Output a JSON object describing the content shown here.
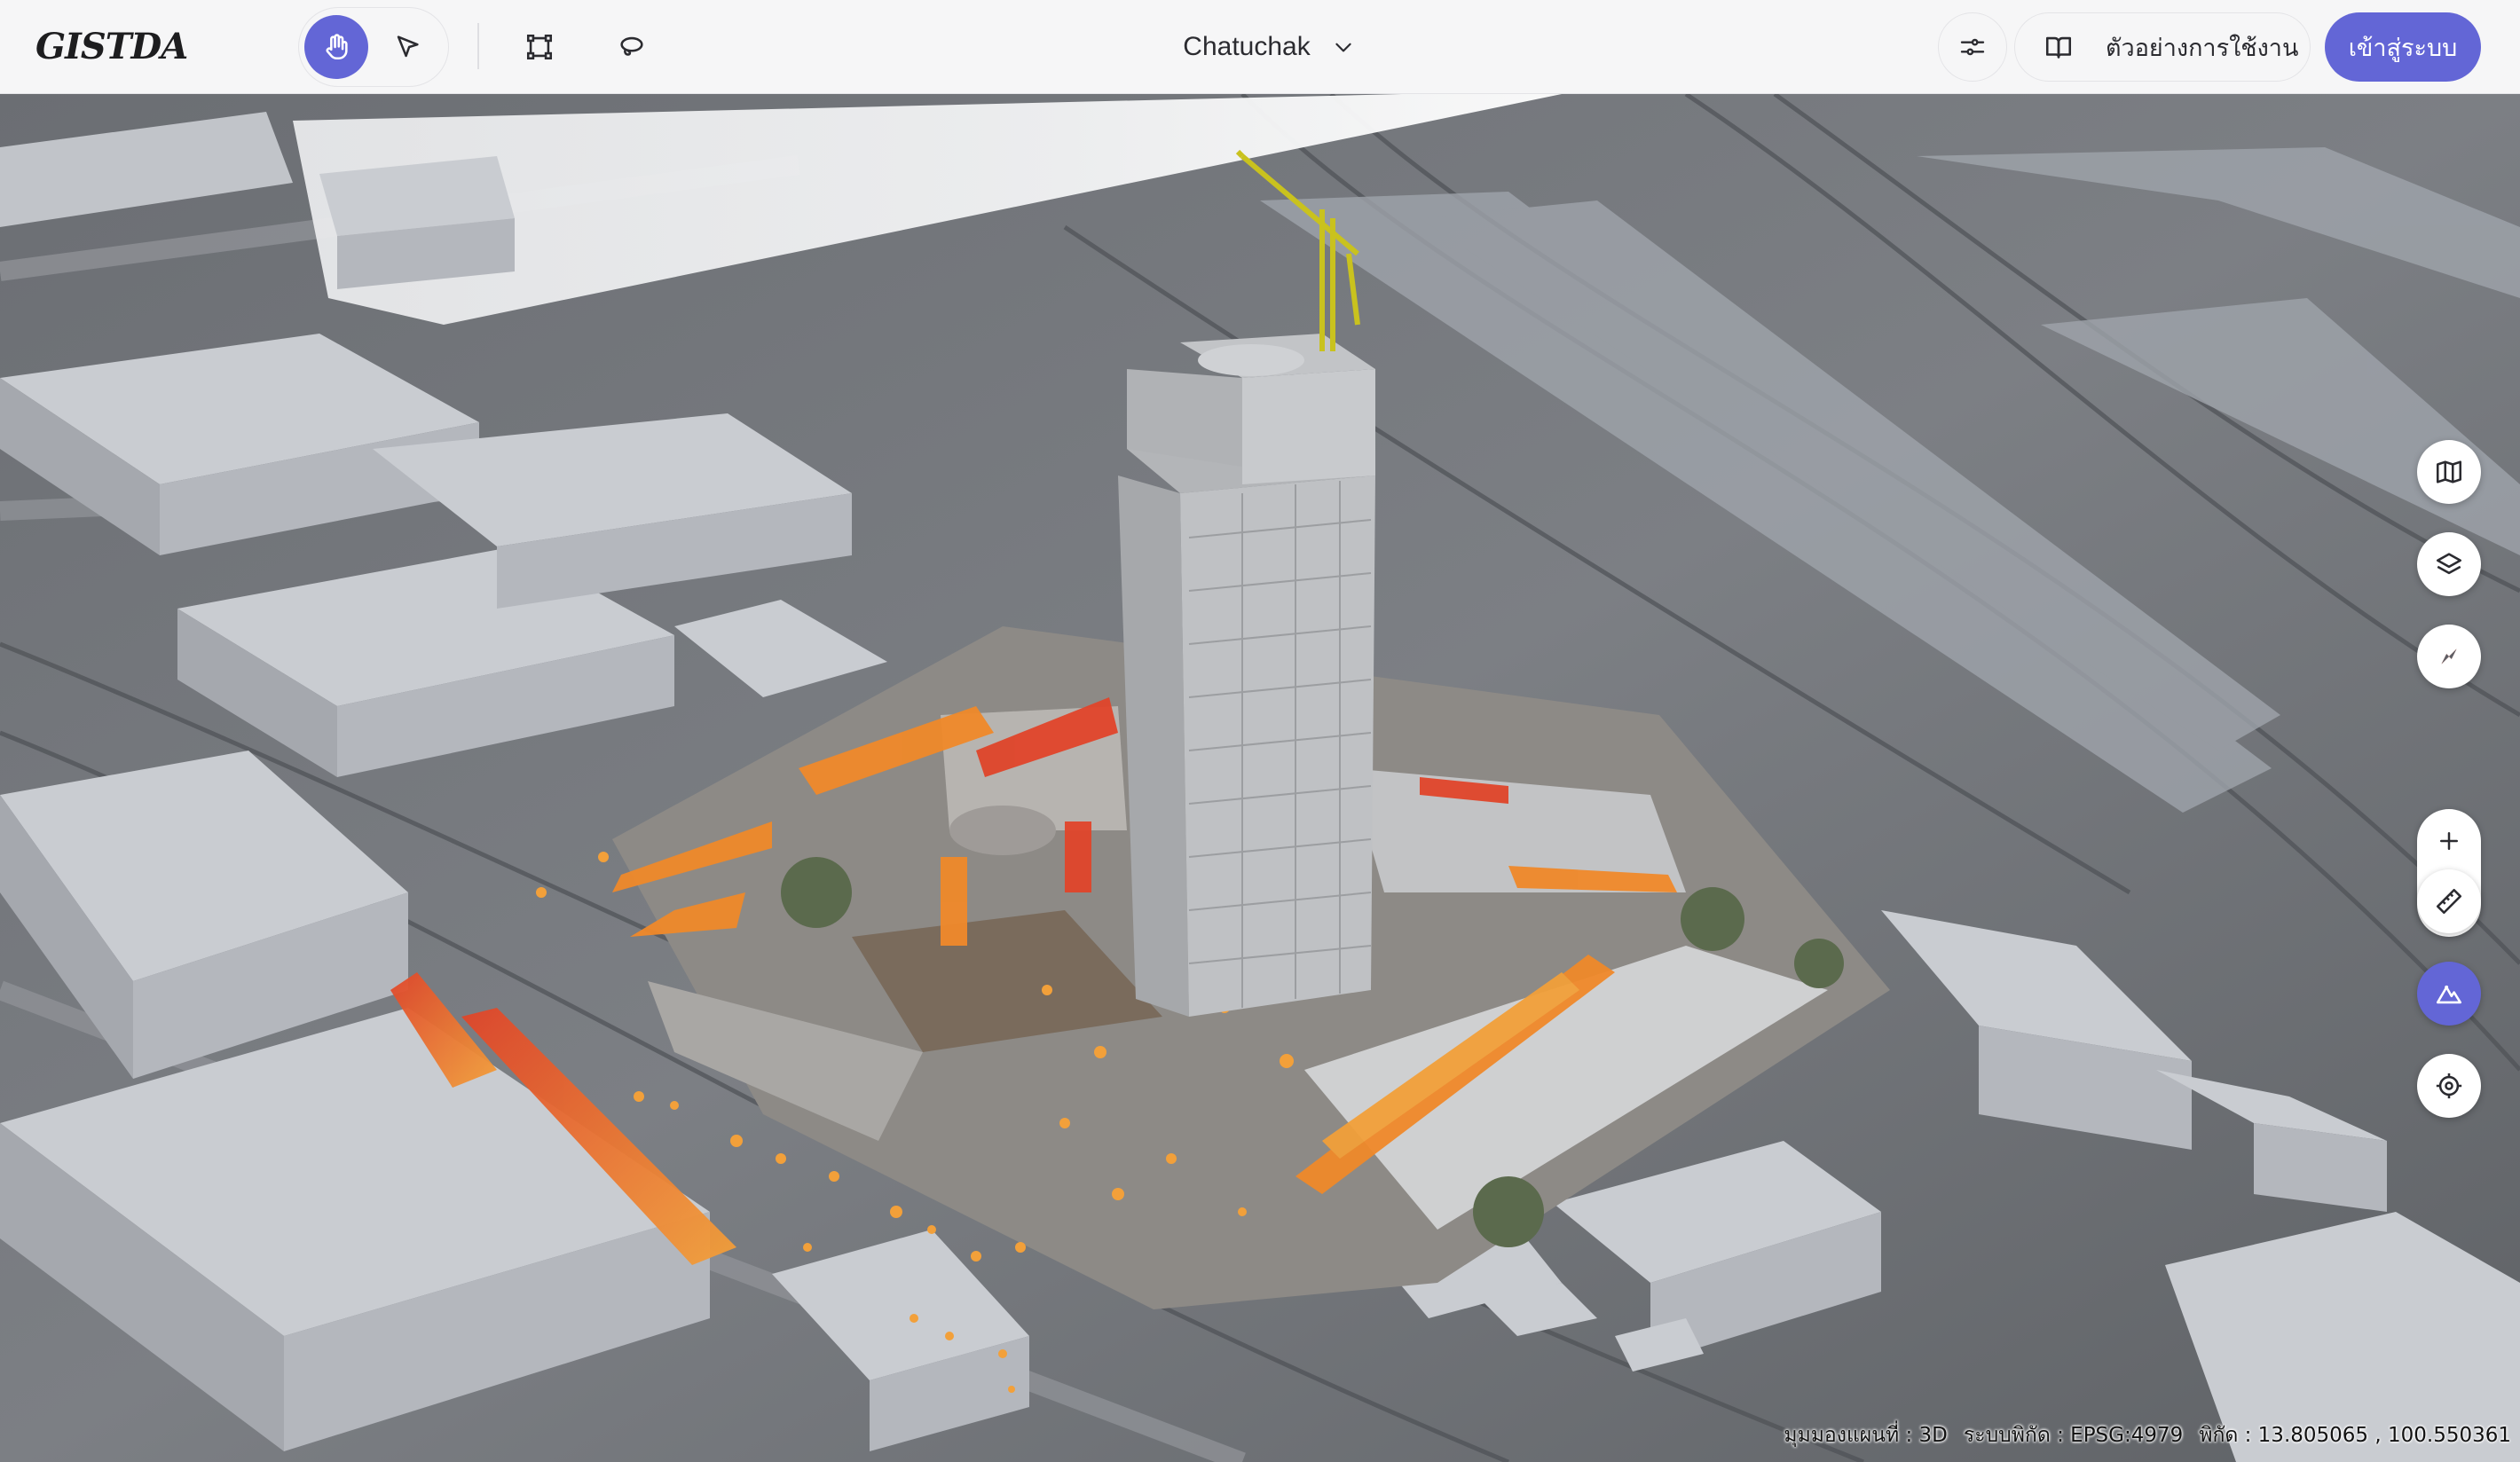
{
  "app": {
    "logo_text": "GISTDA"
  },
  "toolbar": {
    "tools": [
      {
        "name": "pan",
        "icon": "hand-icon",
        "active": true
      },
      {
        "name": "select",
        "icon": "cursor-arrow-icon",
        "active": false
      },
      {
        "name": "polygon",
        "icon": "polygon-draw-icon",
        "active": false
      },
      {
        "name": "lasso",
        "icon": "lasso-icon",
        "active": false
      }
    ],
    "location": "Chatuchak",
    "filter_icon": "sliders-icon",
    "guide_label": "ตัวอย่างการใช้งาน",
    "guide_icon": "book-open-icon",
    "login_label": "เข้าสู่ระบบ"
  },
  "map_controls": [
    {
      "name": "basemap",
      "icon": "map-icon"
    },
    {
      "name": "layers",
      "icon": "layers-icon"
    },
    {
      "name": "compass",
      "icon": "compass-icon"
    },
    {
      "name": "zoom-in",
      "icon": "plus-icon"
    },
    {
      "name": "zoom-out",
      "icon": "minus-icon"
    },
    {
      "name": "measure",
      "icon": "ruler-icon"
    },
    {
      "name": "terrain",
      "icon": "terrain-icon",
      "active": true
    },
    {
      "name": "locate",
      "icon": "target-icon"
    }
  ],
  "status": {
    "view_mode": "มุมมองแผนที่ : 3D",
    "crs": "ระบบพิกัด : EPSG:4979",
    "coords": "พิกัด : 13.805065 , 100.550361"
  },
  "colors": {
    "accent": "#6366d6",
    "pointcloud_orange": "#f0892a",
    "pointcloud_red": "#e0452a",
    "building_gray": "#b9bcc2",
    "crane_yellow": "#c9c21e"
  }
}
